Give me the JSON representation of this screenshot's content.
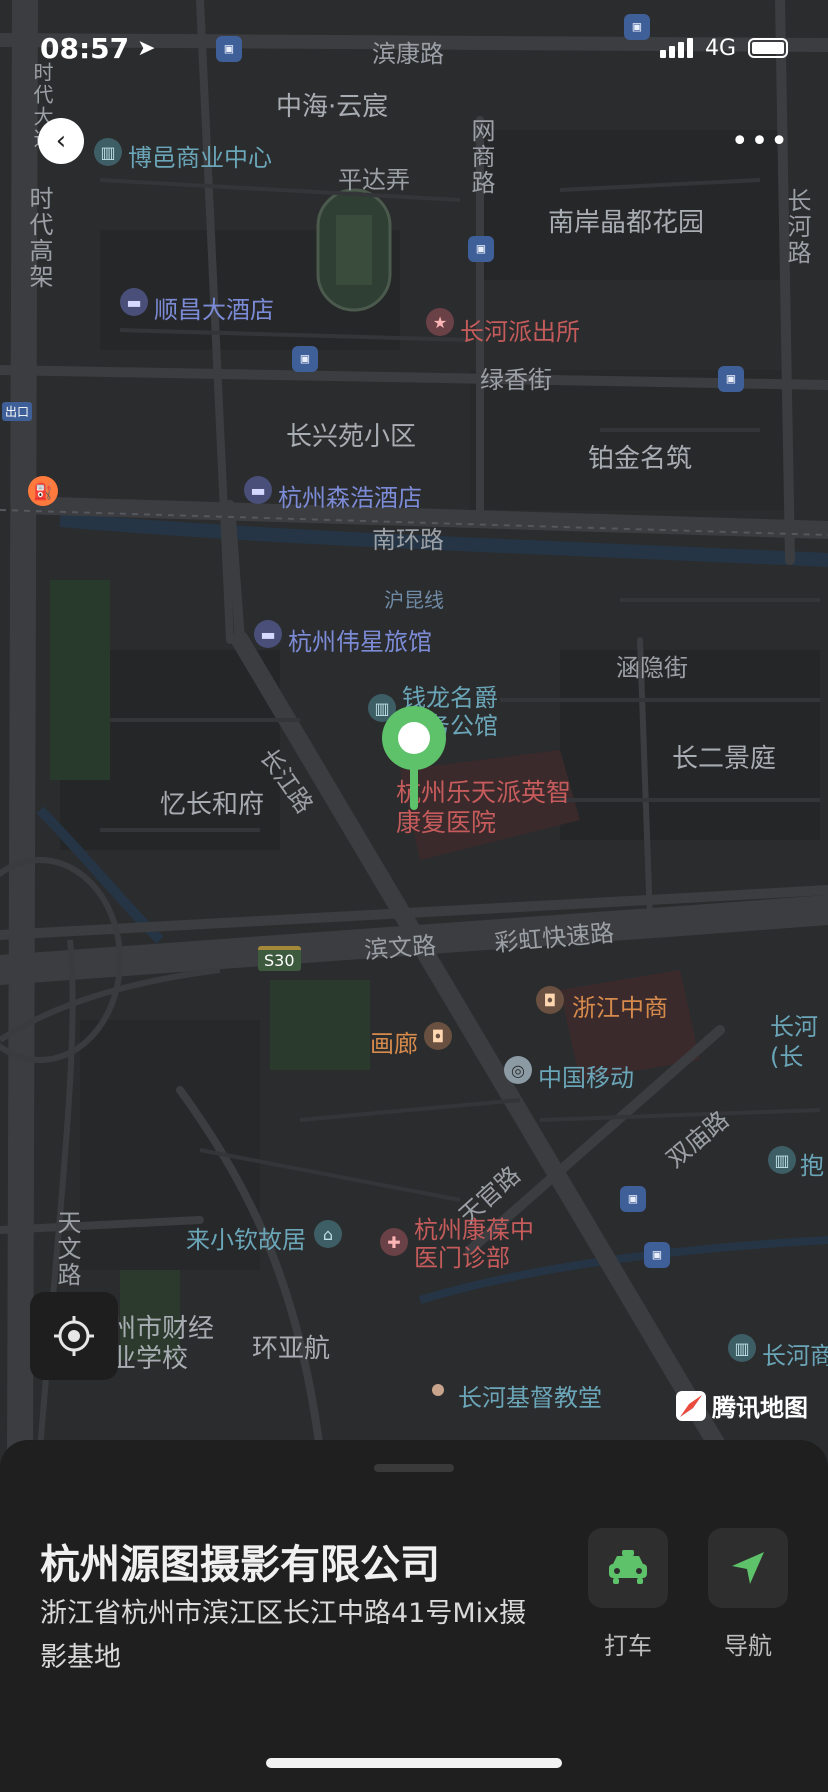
{
  "status_bar": {
    "time": "08:57",
    "network": "4G"
  },
  "map": {
    "labels": {
      "binkang_rd": "滨康路",
      "zhonghai_yunchen": "中海·云宸",
      "wangshang_rd": "网商路",
      "bo_yi": "博邑商业中心",
      "pingda_lane": "平达弄",
      "nan_an_jingdu": "南岸晶都花园",
      "changhe_rd_right": "长河路",
      "shidai_gaojia": "时代高架",
      "shidai_top": "时代大道",
      "shunchang_hotel": "顺昌大酒店",
      "changhe_police": "长河派出所",
      "lvxiang_st": "绿香街",
      "changxingyuan": "长兴苑小区",
      "bojin_mingzhu": "铂金名筑",
      "senhao_hotel": "杭州森浩酒店",
      "nanhuan_rd": "南环路",
      "hukun_line": "沪昆线",
      "weixing_inn": "杭州伟星旅馆",
      "hanyin_st": "涵隐街",
      "qianlong": "钱龙名爵商务公馆",
      "changjiang_rd": "长江路",
      "changer_jingting": "长二景庭",
      "yichang_hefu": "忆长和府",
      "letian_hospital": "杭州乐天派英智康复医院",
      "binwen_rd": "滨文路",
      "caihong_expressway": "彩虹快速路",
      "s30": "S30",
      "zhejiang_zhongshang": "浙江中商",
      "changhe_right": "长河(长",
      "gallery": "画廊",
      "china_mobile": "中国移动",
      "shuangmiao_rd": "双庙路",
      "tianguan_rd": "天官路",
      "bao": "抱",
      "laixiaoqin": "来小钦故居",
      "kangbao_clinic": "杭州康葆中医门诊部",
      "tianwen_rd": "天文路",
      "finance_school": "州市财经业学校",
      "huanyahang": "环亚航",
      "changhe_shang": "长河商",
      "changhe_church": "长河基督教堂",
      "exit": "出口"
    },
    "logo_text": "腾讯地图"
  },
  "sheet": {
    "title": "杭州源图摄影有限公司",
    "address": "浙江省杭州市滨江区长江中路41号Mix摄影基地",
    "actions": [
      {
        "label": "打车",
        "icon": "taxi-icon"
      },
      {
        "label": "导航",
        "icon": "navigate-icon"
      }
    ]
  },
  "colors": {
    "map_bg": "#2b2c2e",
    "pin": "#5dc26a",
    "sheet_bg": "#1f1f1f"
  }
}
